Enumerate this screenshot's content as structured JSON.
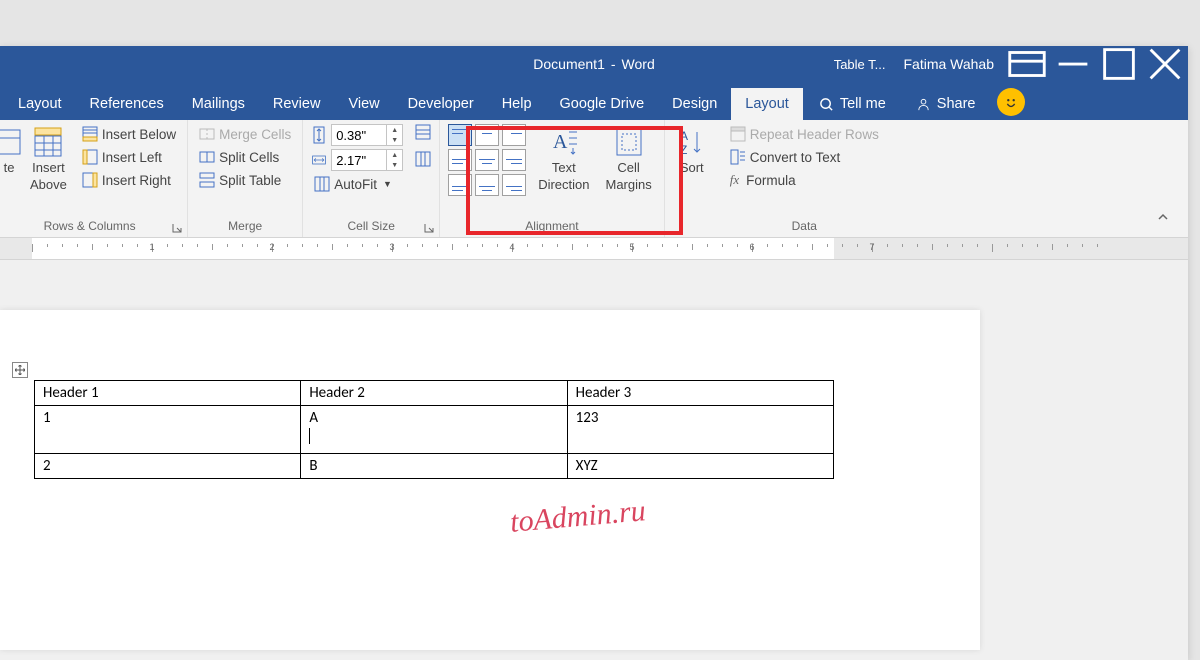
{
  "title": {
    "doc": "Document1",
    "sep": "-",
    "app": "Word"
  },
  "context": {
    "table_tools": "Table T...",
    "user": "Fatima Wahab"
  },
  "tabs": {
    "layout_pg": "Layout",
    "references": "References",
    "mailings": "Mailings",
    "review": "Review",
    "view": "View",
    "developer": "Developer",
    "help": "Help",
    "gdrive": "Google Drive",
    "design": "Design",
    "layout_tbl": "Layout",
    "tell_me": "Tell me",
    "share": "Share"
  },
  "ribbon": {
    "rows_cols": {
      "label": "Rows & Columns",
      "delete": "te",
      "insert": "Insert",
      "above": "Above",
      "below": "Insert Below",
      "left": "Insert Left",
      "right": "Insert Right"
    },
    "merge": {
      "label": "Merge",
      "merge": "Merge Cells",
      "split": "Split Cells",
      "split_table": "Split Table"
    },
    "cell_size": {
      "label": "Cell Size",
      "height": "0.38\"",
      "width": "2.17\"",
      "autofit": "AutoFit"
    },
    "alignment": {
      "label": "Alignment",
      "text_dir": "Text",
      "text_dir2": "Direction",
      "margins": "Cell",
      "margins2": "Margins"
    },
    "sort_group": {
      "sort": "Sort"
    },
    "data": {
      "label": "Data",
      "repeat": "Repeat Header Rows",
      "convert": "Convert to Text",
      "formula": "Formula"
    }
  },
  "ruler": [
    "1",
    "2",
    "3",
    "4",
    "5",
    "6",
    "7"
  ],
  "table": {
    "headers": [
      "Header 1",
      "Header 2",
      "Header 3"
    ],
    "rows": [
      [
        "1",
        "A",
        "123"
      ],
      [
        "2",
        "B",
        "XYZ"
      ]
    ]
  },
  "watermark": "toAdmin.ru"
}
